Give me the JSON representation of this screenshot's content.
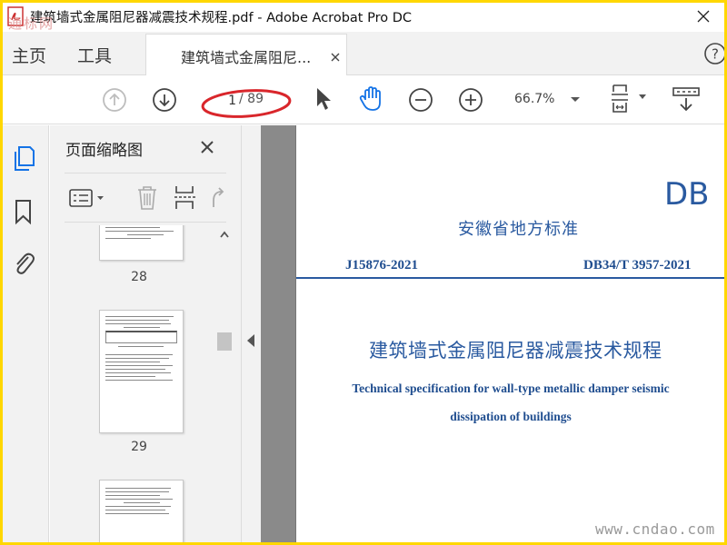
{
  "window": {
    "title": "建筑墙式金属阻尼器减震技术规程.pdf - Adobe Acrobat Pro DC"
  },
  "tabs": {
    "home": "主页",
    "tools": "工具",
    "document": "建筑墙式金属阻尼..."
  },
  "toolbar": {
    "page_current": "1",
    "page_total": "/ 89",
    "zoom": "66.7%"
  },
  "thumbnails_panel": {
    "title": "页面缩略图",
    "pages": [
      {
        "number": "28"
      },
      {
        "number": "29"
      },
      {
        "number": ""
      }
    ]
  },
  "document": {
    "db_mark": "DB",
    "local_standard": "安徽省地方标准",
    "code_left": "J15876-2021",
    "code_right": "DB34/T 3957-2021",
    "title_cn": "建筑墙式金属阻尼器减震技术规程",
    "title_en_line1": "Technical specification for wall-type metallic damper seismic",
    "title_en_line2": "dissipation of buildings"
  },
  "watermark": {
    "cn": "通标网",
    "url": "www.cndao.com"
  },
  "colors": {
    "frame": "#ffd700",
    "doc_blue": "#2a5aa0",
    "accent_blue": "#1473e6",
    "annotation_red": "#d9262b"
  }
}
